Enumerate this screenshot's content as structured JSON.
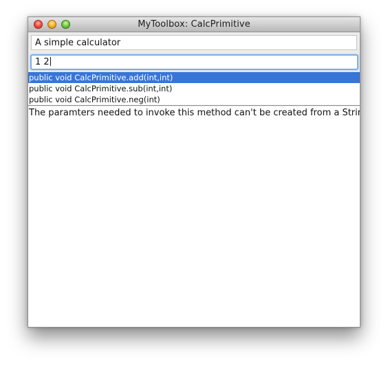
{
  "window": {
    "title": "MyToolbox: CalcPrimitive"
  },
  "description": {
    "value": "A simple calculator"
  },
  "input": {
    "value": "1 2"
  },
  "methods": [
    {
      "label": "public void CalcPrimitive.add(int,int)",
      "selected": true
    },
    {
      "label": "public void CalcPrimitive.sub(int,int)",
      "selected": false
    },
    {
      "label": "public void CalcPrimitive.neg(int)",
      "selected": false
    }
  ],
  "result": {
    "text": "The paramters needed to invoke this method can't be created from a String"
  },
  "colors": {
    "selection": "#3875d7",
    "focus_ring": "#7aaee6"
  }
}
